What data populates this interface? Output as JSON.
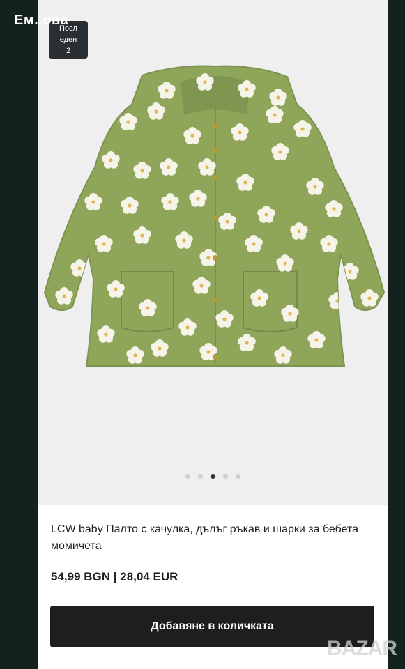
{
  "overlay": {
    "name": "Ем..ова"
  },
  "badge": {
    "line1": "Посл",
    "line2": "еден",
    "line3": "2"
  },
  "carousel": {
    "total": 5,
    "active_index": 2
  },
  "product": {
    "title": "LCW baby Палто с качулка, дълъг ръкав и шарки за бебета момичета",
    "price": "54,99 BGN | 28,04 EUR"
  },
  "actions": {
    "add_to_cart": "Добавяне в количката"
  },
  "watermark": "BAZAR",
  "colors": {
    "jacket": "#8fa65a",
    "flower": "#f6f3e8",
    "button": "#1c1e20"
  }
}
